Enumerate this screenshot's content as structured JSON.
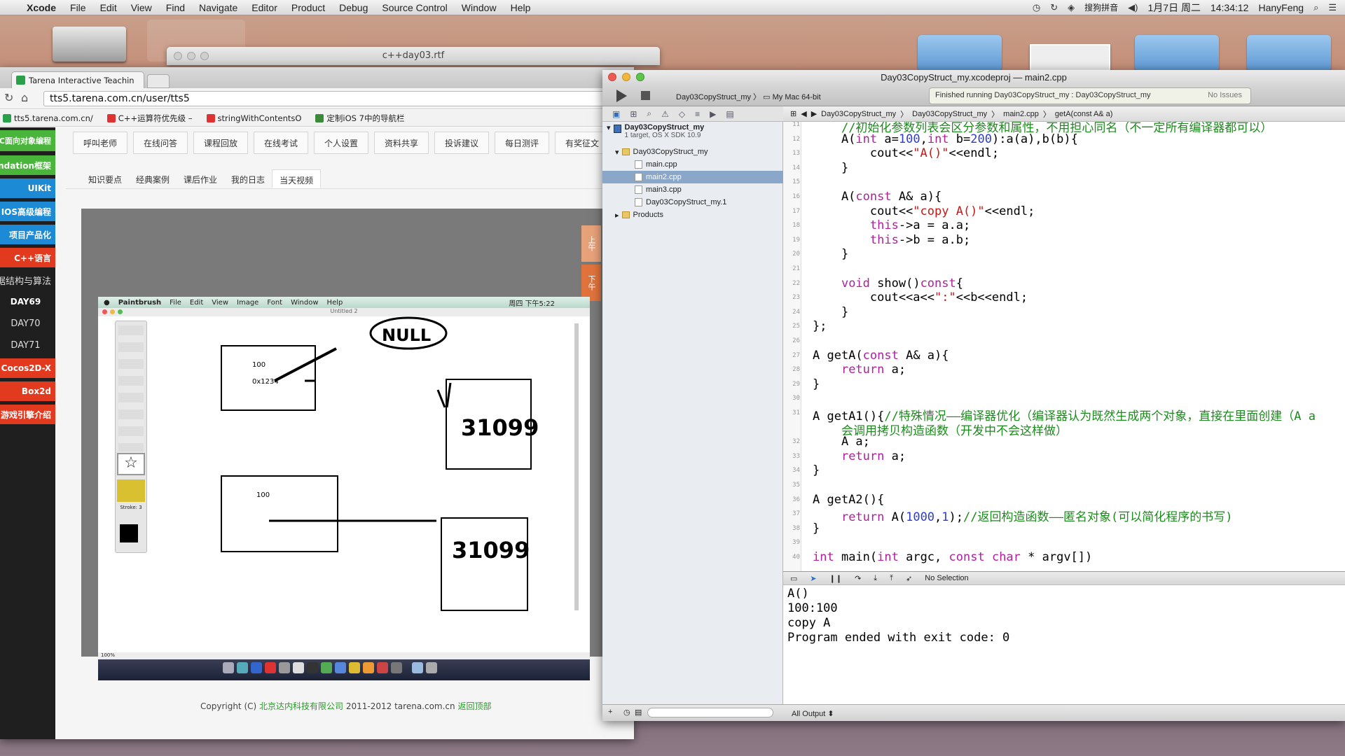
{
  "menubar": {
    "app": "Xcode",
    "items": [
      "File",
      "Edit",
      "View",
      "Find",
      "Navigate",
      "Editor",
      "Product",
      "Debug",
      "Source Control",
      "Window",
      "Help"
    ],
    "status_right": [
      "搜狗拼音",
      "1月7日 周二",
      "14:34:12",
      "HanyFeng"
    ]
  },
  "rtf_window": {
    "title": "c++day03.rtf"
  },
  "browser": {
    "tab_title": "Tarena Interactive Teachin",
    "address": "tts5.tarena.com.cn/user/tts5",
    "bookmarks": [
      "tts5.tarena.com.cn/",
      "C++运算符优先级 –",
      "stringWithContentsO",
      "定制iOS 7中的导航栏"
    ],
    "left_nav": [
      {
        "label": "ve-C面向对象编程",
        "style": "green"
      },
      {
        "label": "undation框架",
        "style": "green"
      },
      {
        "label": "UIKit",
        "style": "blue"
      },
      {
        "label": "IOS高级编程",
        "style": "blue"
      },
      {
        "label": "项目产品化",
        "style": "blue"
      },
      {
        "label": "C++语言",
        "style": "red"
      },
      {
        "label": "据结构与算法",
        "style": "dark"
      },
      {
        "label": "DAY69",
        "style": "active"
      },
      {
        "label": "DAY70",
        "style": "dark"
      },
      {
        "label": "DAY71",
        "style": "dark"
      },
      {
        "label": "Cocos2D-X",
        "style": "red"
      },
      {
        "label": "Box2d",
        "style": "red"
      },
      {
        "label": "游戏引擎介绍",
        "style": "red"
      }
    ],
    "top_links": [
      "呼叫老师",
      "在线问答",
      "课程回放",
      "在线考试",
      "个人设置",
      "资料共享",
      "投诉建议",
      "每日测评",
      "有奖征文"
    ],
    "sub_tabs": [
      "知识要点",
      "经典案例",
      "课后作业",
      "我的日志",
      "当天视频"
    ],
    "active_sub_tab": 4,
    "side_tabs": [
      "上午",
      "下午"
    ],
    "copyright_prefix": "Copyright (C)",
    "copyright_company": "北京达内科技有限公司",
    "copyright_years": "2011-2012 tarena.com.cn",
    "back_to_top": "返回顶部"
  },
  "paintbrush": {
    "menus": [
      "Paintbrush",
      "File",
      "Edit",
      "View",
      "Image",
      "Font",
      "Window",
      "Help"
    ],
    "clock": "周四 下午5:22",
    "doc_title": "Untitled 2",
    "stroke_label": "Stroke: 3",
    "zoom": "100%",
    "drawing": {
      "box1_value": "100",
      "box1_ptr": "0x1234",
      "null_label": "NULL",
      "box2_value": "31099",
      "box3_value": "100",
      "box4_value": "31099"
    }
  },
  "xcode": {
    "title_project": "Day03CopyStruct_my.xcodeproj",
    "title_file": "main2.cpp",
    "scheme": "Day03CopyStruct_my",
    "destination": "My Mac 64-bit",
    "activity": "Finished running Day03CopyStruct_my : Day03CopyStruct_my",
    "issues": "No Issues",
    "jump_bar": [
      "Day03CopyStruct_my",
      "Day03CopyStruct_my",
      "main2.cpp",
      "getA(const A& a)"
    ],
    "navigator": [
      {
        "label": "Day03CopyStruct_my",
        "sub": "1 target, OS X SDK 10.9",
        "type": "proj",
        "indent": 0,
        "sel": false
      },
      {
        "label": "Day03CopyStruct_my",
        "type": "folder",
        "indent": 1,
        "sel": false
      },
      {
        "label": "main.cpp",
        "type": "file",
        "indent": 2,
        "sel": false
      },
      {
        "label": "main2.cpp",
        "type": "file",
        "indent": 2,
        "sel": true
      },
      {
        "label": "main3.cpp",
        "type": "file",
        "indent": 2,
        "sel": false
      },
      {
        "label": "Day03CopyStruct_my.1",
        "type": "file",
        "indent": 2,
        "sel": false
      },
      {
        "label": "Products",
        "type": "folder",
        "indent": 1,
        "sel": false
      }
    ],
    "line_numbers": [
      "11",
      "12",
      "13",
      "14",
      "15",
      "16",
      "17",
      "18",
      "19",
      "20",
      "21",
      "22",
      "23",
      "24",
      "25",
      "26",
      "27",
      "28",
      "29",
      "30",
      "31",
      "",
      "32",
      "33",
      "34",
      "35",
      "36",
      "37",
      "38",
      "39",
      "40"
    ],
    "code_lines": [
      "    //初始化参数列表会区分参数和属性，不用担心同名（不一定所有编译器都可以）",
      "    A(int a=100,int b=200):a(a),b(b){",
      "        cout<<\"A()\"<<endl;",
      "    }",
      "",
      "    A(const A& a){",
      "        cout<<\"copy A()\"<<endl;",
      "        this->a = a.a;",
      "        this->b = a.b;",
      "    }",
      "",
      "    void show()const{",
      "        cout<<a<<\":\"<<b<<endl;",
      "    }",
      "};",
      "",
      "A getA(const A& a){",
      "    return a;",
      "}",
      "",
      "A getA1(){//特殊情况——编译器优化（编译器认为既然生成两个对象，直接在里面创建（A a",
      "    会调用拷贝构造函数（开发中不会这样做）",
      "    A a;",
      "    return a;",
      "}",
      "",
      "A getA2(){",
      "    return A(1000,1);//返回构造函数——匿名对象(可以简化程序的书写)",
      "}",
      "",
      "int main(int argc, const char * argv[])"
    ],
    "debug_bar_label": "No Selection",
    "console_output": "A()\n100:100\ncopy A\nProgram ended with exit code: 0",
    "output_selector": "All Output"
  }
}
